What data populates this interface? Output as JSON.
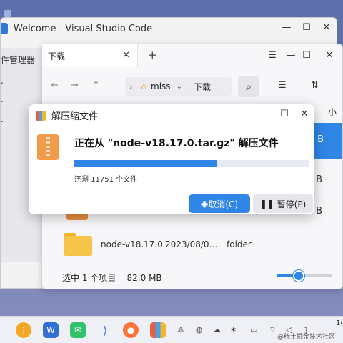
{
  "vscode": {
    "title": "Welcome - Visual Studio Code",
    "sidebar_label": "件管理器",
    "sidebar_dots": [
      ".",
      ".",
      "."
    ],
    "controls": {
      "min": "—",
      "max": "☐",
      "close": "✕"
    }
  },
  "file_manager": {
    "tab_label": "下载",
    "tab_close": "✕",
    "new_tab": "+",
    "controls": {
      "menu": "☰",
      "min": "—",
      "max": "☐",
      "close": "✕"
    },
    "nav": {
      "back": "←",
      "forward": "→",
      "up": "↑"
    },
    "breadcrumb": {
      "home": "miss",
      "current": "下载"
    },
    "search_icon": "⌕",
    "view_icons": {
      "list": "☰",
      "sort": "⇅"
    },
    "size_header": "小",
    "size_unit_partial": "B",
    "rows": [
      {
        "name": "node-v18.17.0",
        "date": "2023/08/0…",
        "type": "folder"
      }
    ],
    "status": {
      "selected": "选中 1 个项目",
      "size": "82.0 MB"
    },
    "zoom_fraction": 0.4
  },
  "dialog": {
    "title": "解压缩文件",
    "controls": {
      "min": "—",
      "max": "☐",
      "close": "✕"
    },
    "message": "正在从 \"node-v18.17.0.tar.gz\" 解压文件",
    "progress_fraction": 0.61,
    "remaining": "还剩 11751 个文件",
    "cancel_label": "取消(C)",
    "pause_label": "暂停(P)"
  },
  "taskbar": {
    "apps": [
      "launcher",
      "wps",
      "wechat",
      "vscode",
      "firefox",
      "archive"
    ],
    "clock": "1(",
    "watermark": "@稀土掘金技术社区"
  },
  "colors": {
    "accent": "#2f86e6",
    "folder": "#f7c44a"
  }
}
